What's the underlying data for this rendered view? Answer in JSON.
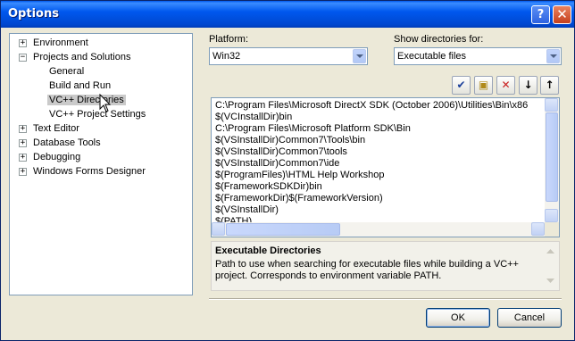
{
  "window": {
    "title": "Options",
    "help_label": "?",
    "close_label": "✕"
  },
  "tree": {
    "items": [
      {
        "label": "Environment",
        "expander": "+"
      },
      {
        "label": "Projects and Solutions",
        "expander": "−"
      },
      {
        "label": "General",
        "expander": ""
      },
      {
        "label": "Build and Run",
        "expander": ""
      },
      {
        "label": "VC++ Directories",
        "expander": "",
        "selected": true
      },
      {
        "label": "VC++ Project Settings",
        "expander": ""
      },
      {
        "label": "Text Editor",
        "expander": "+"
      },
      {
        "label": "Database Tools",
        "expander": "+"
      },
      {
        "label": "Debugging",
        "expander": "+"
      },
      {
        "label": "Windows Forms Designer",
        "expander": "+"
      }
    ]
  },
  "platform": {
    "label": "Platform:",
    "value": "Win32"
  },
  "show_dirs": {
    "label": "Show directories for:",
    "value": "Executable files"
  },
  "toolbar": {
    "check_icon": "✔",
    "new_folder_icon": "▣",
    "delete_icon": "✕",
    "move_down_icon": "↓",
    "move_up_icon": "↑"
  },
  "directories": [
    "C:\\Program Files\\Microsoft DirectX SDK (October 2006)\\Utilities\\Bin\\x86",
    "$(VCInstallDir)bin",
    "C:\\Program Files\\Microsoft Platform SDK\\Bin",
    "$(VSInstallDir)Common7\\Tools\\bin",
    "$(VSInstallDir)Common7\\tools",
    "$(VSInstallDir)Common7\\ide",
    "$(ProgramFiles)\\HTML Help Workshop",
    "$(FrameworkSDKDir)bin",
    "$(FrameworkDir)$(FrameworkVersion)",
    "$(VSInstallDir)",
    "$(PATH)"
  ],
  "description": {
    "title": "Executable Directories",
    "body": "Path to use when searching for executable files while building a VC++ project.  Corresponds to environment variable PATH."
  },
  "buttons": {
    "ok": "OK",
    "cancel": "Cancel"
  }
}
